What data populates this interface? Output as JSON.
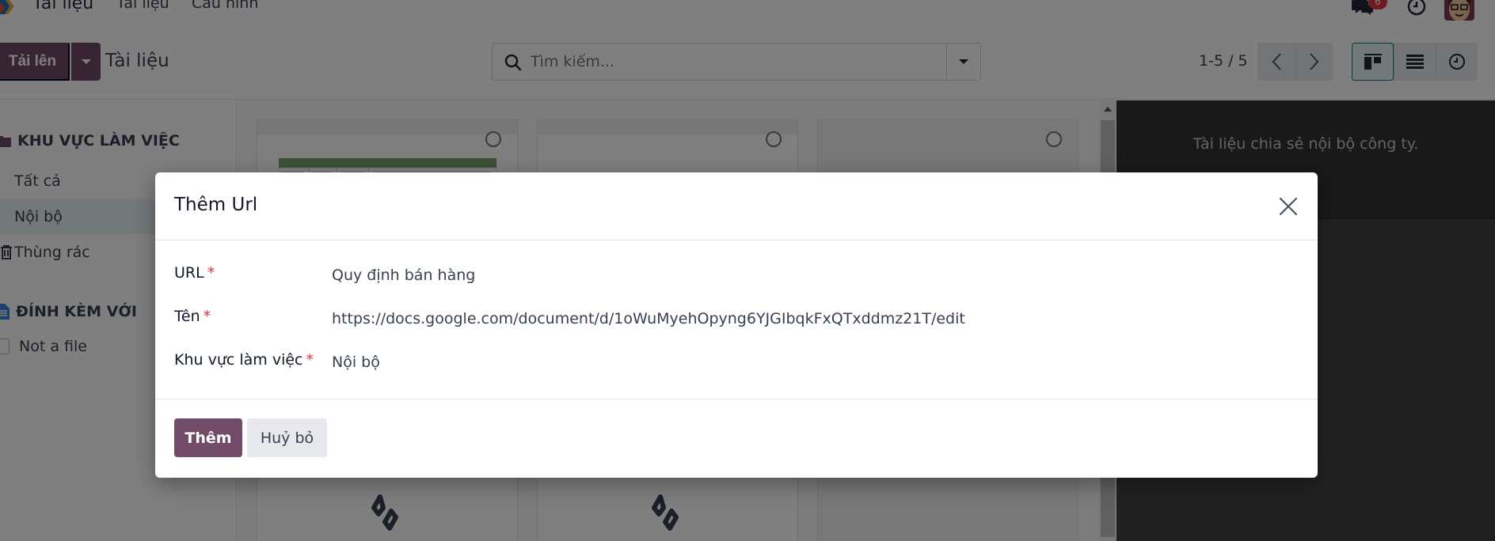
{
  "navbar": {
    "app_name": "Tài liệu",
    "menu": [
      "Tài liệu",
      "Cấu hình"
    ],
    "message_badge": "6"
  },
  "control_panel": {
    "upload_label": "Tải lên",
    "breadcrumb": "Tài liệu",
    "search_placeholder": "Tìm kiếm...",
    "pager_value": "1-5 / 5",
    "views": [
      "kanban",
      "list",
      "activity"
    ],
    "active_view": "kanban"
  },
  "sidebar": {
    "workspace_header": "KHU VỰC LÀM VIỆC",
    "workspace_items": [
      {
        "label": "Tất cả",
        "active": false
      },
      {
        "label": "Nội bộ",
        "active": true
      },
      {
        "label": "Thùng rác",
        "active": false
      }
    ],
    "attached_header": "ĐÍNH KÈM VỚI",
    "attached_items": [
      {
        "label": "Not a file",
        "checked": false
      }
    ]
  },
  "inspector": {
    "description": "Tài liệu chia sẻ nội bộ công ty."
  },
  "modal": {
    "title": "Thêm Url",
    "fields": [
      {
        "label": "URL",
        "required": true,
        "value": "Quy định bán hàng"
      },
      {
        "label": "Tên",
        "required": true,
        "value": "https://docs.google.com/document/d/1oWuMyehOpyng6YJGIbqkFxQTxddmz21T/edit"
      },
      {
        "label": "Khu vực làm việc",
        "required": true,
        "value": "Nội bộ"
      }
    ],
    "required_mark": "*",
    "primary_label": "Thêm",
    "secondary_label": "Huỷ bỏ"
  },
  "colors": {
    "brand": "#714b67",
    "active_view_border": "#017e84",
    "required": "#dc3545"
  }
}
